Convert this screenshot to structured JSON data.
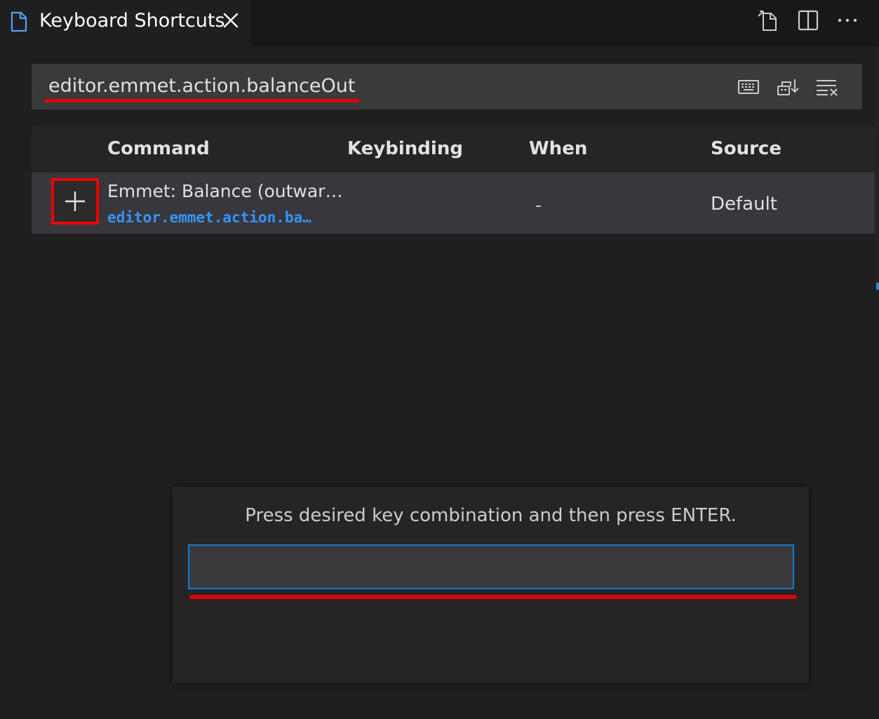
{
  "tab": {
    "title": "Keyboard Shortcuts"
  },
  "tab_actions": [
    "open-file-icon",
    "split-editor-icon",
    "more-actions-icon"
  ],
  "search": {
    "value": "editor.emmet.action.balanceOut",
    "icons": [
      "record-keys-icon",
      "sort-by-precedence-icon",
      "clear-filter-icon"
    ]
  },
  "table": {
    "headers": {
      "command": "Command",
      "keybinding": "Keybinding",
      "when": "When",
      "source": "Source"
    },
    "rows": [
      {
        "command_label": "Emmet: Balance (outwar…",
        "command_id": "editor.emmet.action.ba…",
        "keybinding": "",
        "when": "-",
        "source": "Default"
      }
    ]
  },
  "dialog": {
    "message": "Press desired key combination and then press ENTER.",
    "input_value": ""
  },
  "colors": {
    "background": "#1f1f1f",
    "accent_blue": "#3794ff",
    "annotation_red": "#e00000"
  }
}
